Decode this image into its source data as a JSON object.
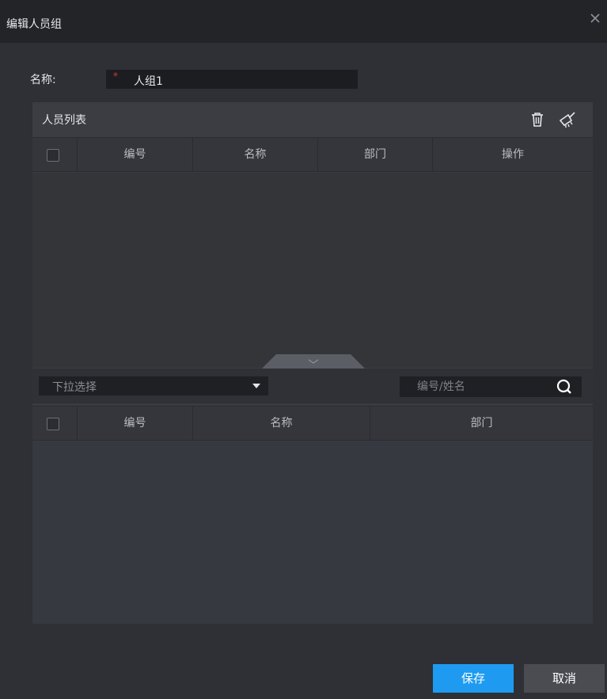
{
  "window": {
    "title": "编辑人员组"
  },
  "form": {
    "name_label": "名称:",
    "required_mark": "*",
    "name_value": "人组1"
  },
  "members_panel": {
    "title": "人员列表",
    "columns": [
      "编号",
      "名称",
      "部门",
      "操作"
    ],
    "rows": []
  },
  "filter": {
    "dropdown_placeholder": "下拉选择",
    "search_placeholder": "编号/姓名"
  },
  "candidates_table": {
    "columns": [
      "编号",
      "名称",
      "部门"
    ],
    "rows": []
  },
  "buttons": {
    "save": "保存",
    "cancel": "取消"
  },
  "colors": {
    "accent": "#1e9bf0",
    "required": "#d83a3a"
  },
  "icons": [
    "close-icon",
    "delete-icon",
    "clear-icon",
    "chevron-down-icon",
    "caret-down-icon",
    "search-icon"
  ]
}
